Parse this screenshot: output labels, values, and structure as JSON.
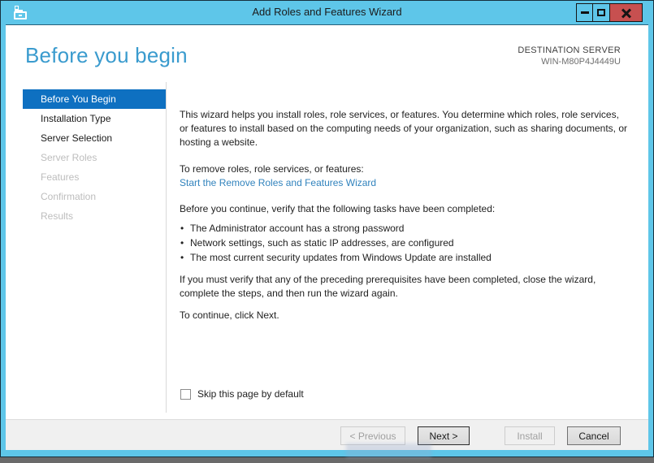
{
  "window": {
    "title": "Add Roles and Features Wizard",
    "controls": {
      "minimize": "minimize-icon",
      "maximize": "maximize-icon",
      "close": "close-icon"
    },
    "colors": {
      "titlebar": "#5ec6e9",
      "close_button": "#c75050",
      "frame_border": "#16303d"
    }
  },
  "header": {
    "title": "Before you begin",
    "destination_label": "DESTINATION SERVER",
    "destination_value": "WIN-M80P4J4449U"
  },
  "sidebar": {
    "items": [
      {
        "label": "Before You Begin",
        "state": "selected"
      },
      {
        "label": "Installation Type",
        "state": "enabled"
      },
      {
        "label": "Server Selection",
        "state": "enabled"
      },
      {
        "label": "Server Roles",
        "state": "disabled"
      },
      {
        "label": "Features",
        "state": "disabled"
      },
      {
        "label": "Confirmation",
        "state": "disabled"
      },
      {
        "label": "Results",
        "state": "disabled"
      }
    ],
    "selected_color": "#0e70c1"
  },
  "content": {
    "intro": "This wizard helps you install roles, role services, or features. You determine which roles, role services, or features to install based on the computing needs of your organization, such as sharing documents, or hosting a website.",
    "remove_line": "To remove roles, role services, or features:",
    "remove_link": "Start the Remove Roles and Features Wizard",
    "verify_line": "Before you continue, verify that the following tasks have been completed:",
    "bullet_char": "•",
    "bullets": [
      "The Administrator account has a strong password",
      "Network settings, such as static IP addresses, are configured",
      "The most current security updates from Windows Update are installed"
    ],
    "prereq_line": "If you must verify that any of the preceding prerequisites have been completed, close the wizard, complete the steps, and then run the wizard again.",
    "continue_line": "To continue, click Next.",
    "link_color": "#3183bd",
    "heading_color": "#3a9bce"
  },
  "skip_checkbox": {
    "label": "Skip this page by default",
    "checked": false
  },
  "footer": {
    "buttons": [
      {
        "label": "< Previous",
        "state": "disabled"
      },
      {
        "label": "Next >",
        "state": "default"
      },
      {
        "label": "Install",
        "state": "disabled"
      },
      {
        "label": "Cancel",
        "state": "enabled"
      }
    ]
  }
}
